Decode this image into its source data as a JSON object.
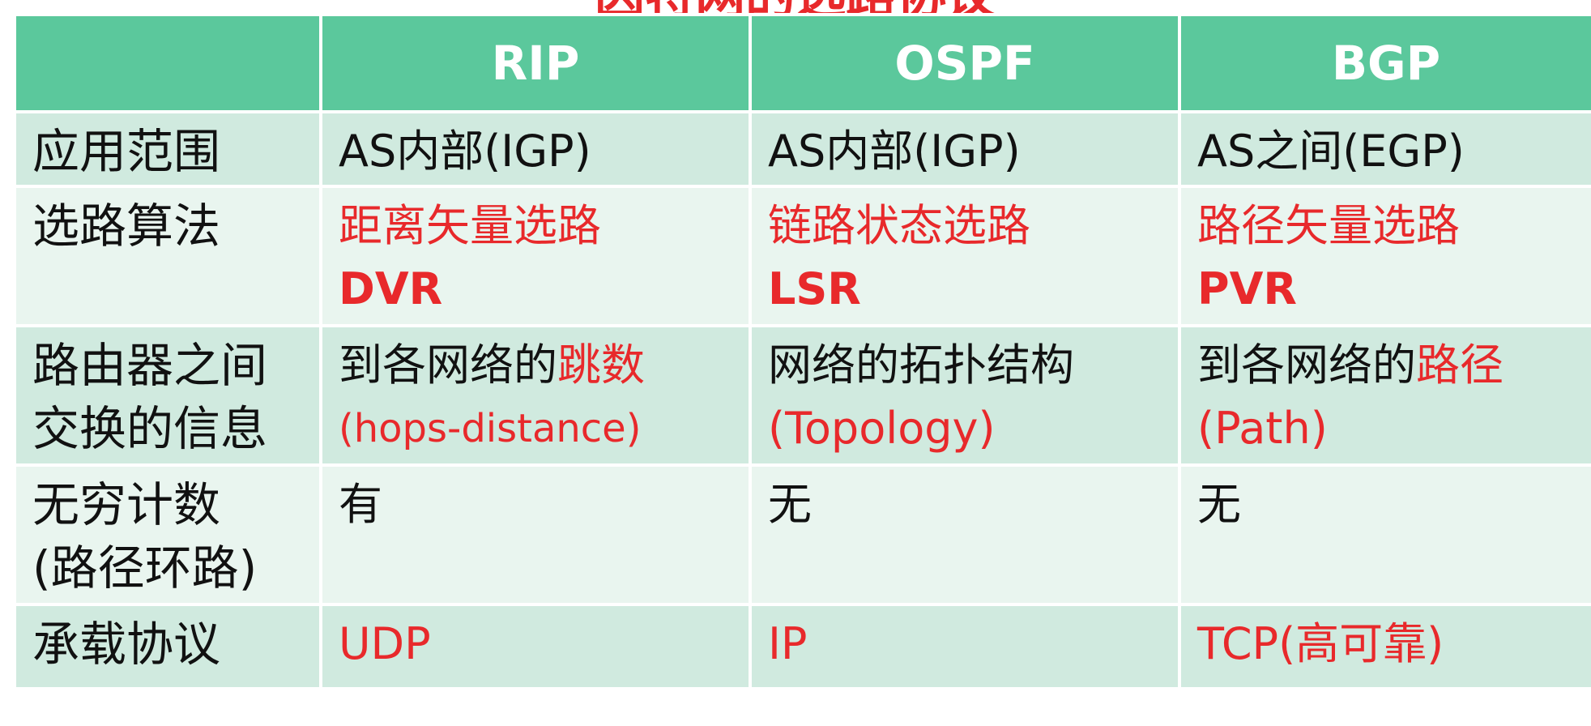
{
  "title": "因特网的选路协议",
  "table": {
    "headers": [
      "",
      "RIP",
      "OSPF",
      "BGP"
    ],
    "rows": {
      "scope": {
        "label": "应用范围",
        "rip": "AS内部(IGP)",
        "ospf": "AS内部(IGP)",
        "bgp": "AS之间(EGP)"
      },
      "algorithm": {
        "label": "选路算法",
        "rip": {
          "line1": "距离矢量选路",
          "line2": "DVR"
        },
        "ospf": {
          "line1": "链路状态选路",
          "line2": "LSR"
        },
        "bgp": {
          "line1": "路径矢量选路",
          "line2": "PVR"
        }
      },
      "info": {
        "label_line1": "路由器之间",
        "label_line2": "交换的信息",
        "rip": {
          "prefix": "到各网络的",
          "highlight": "跳数",
          "line2": "(hops-distance)"
        },
        "ospf": {
          "line1": "网络的拓扑结构",
          "line2": "(Topology)"
        },
        "bgp": {
          "prefix": "到各网络的",
          "highlight": "路径",
          "line2": "(Path)"
        }
      },
      "count_to_infinity": {
        "label_line1": "无穷计数",
        "label_line2": "(路径环路)",
        "rip": "有",
        "ospf": "无",
        "bgp": "无"
      },
      "transport": {
        "label": "承载协议",
        "rip": "UDP",
        "ospf": "IP",
        "bgp": "TCP(高可靠)"
      }
    }
  },
  "colors": {
    "header_bg": "#5bc89c",
    "row_dark": "#d0eadf",
    "row_light": "#e9f5ef",
    "accent_red": "#e8292b"
  }
}
